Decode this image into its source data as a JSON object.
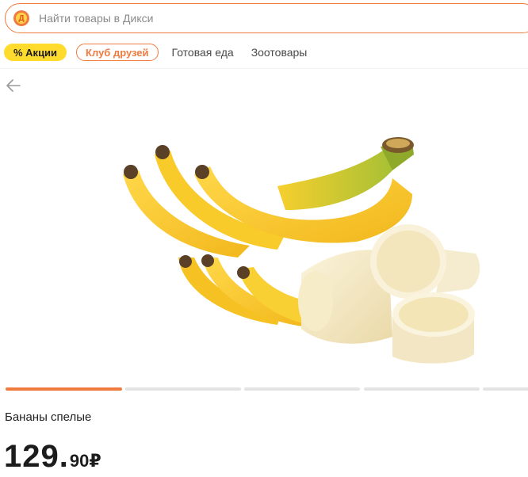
{
  "search": {
    "placeholder": "Найти товары в Дикси",
    "logo_letter": "Д"
  },
  "nav": {
    "promo_label": "% Акции",
    "club_label": "Клуб друзей",
    "links": [
      "Готовая еда",
      "Зоотовары"
    ]
  },
  "product": {
    "title": "Бананы спелые",
    "price_int": "129",
    "price_dot": ".",
    "price_frac": "90",
    "currency": "₽"
  },
  "carousel": {
    "total_slides": 5,
    "active_index": 0
  },
  "colors": {
    "accent": "#f07b3f",
    "promo": "#ffdb2e"
  }
}
